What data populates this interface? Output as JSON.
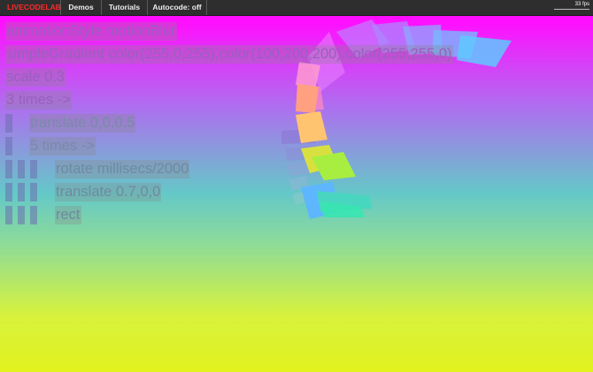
{
  "topbar": {
    "logo": "LIVECODELAB",
    "demos": "Demos",
    "tutorials": "Tutorials",
    "autocode": "Autocode: off",
    "fps": "33 fps"
  },
  "code_lines": [
    "animationStyle motionBlur",
    "simpleGradient color(255,0,255),color(100,200,200),color(255,255,0)",
    "scale 0.3",
    "3 times ->",
    "translate 0,0,0.5",
    "5 times ->",
    "rotate millisecs/2000",
    "translate 0.7,0,0",
    "rect"
  ],
  "colors": {
    "topbar": "#2e2e2e",
    "logo": "#ff2a2a",
    "gradient_top": "#ff00ff",
    "gradient_mid": "#64c8c8",
    "gradient_bottom": "#e2f21e"
  }
}
